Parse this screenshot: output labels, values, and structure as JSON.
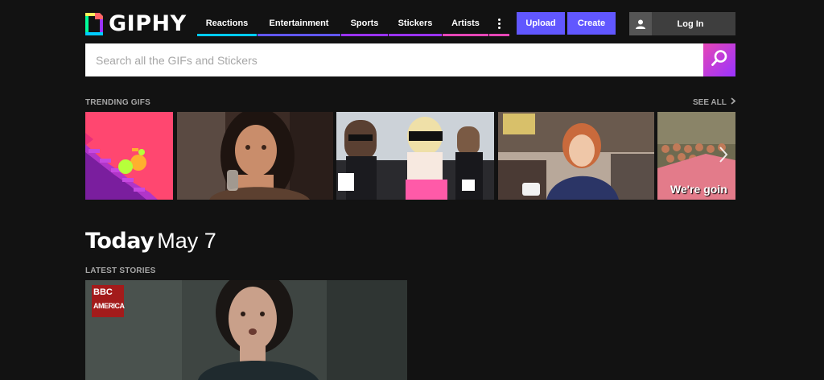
{
  "brand": {
    "name": "GIPHY"
  },
  "nav": {
    "items": [
      {
        "label": "Reactions",
        "color": "#00ccff"
      },
      {
        "label": "Entertainment",
        "color": "#6157ff"
      },
      {
        "label": "Sports",
        "color": "#9933ff"
      },
      {
        "label": "Stickers",
        "color": "#9933ff"
      },
      {
        "label": "Artists",
        "color": "#e646b6"
      }
    ],
    "more_icon": "more-vertical-icon",
    "more_color": "#e646b6"
  },
  "header": {
    "upload_label": "Upload",
    "create_label": "Create",
    "login_label": "Log In",
    "login_icon": "user-icon",
    "accent": "#6157ff"
  },
  "search": {
    "placeholder": "Search all the GIFs and Stickers",
    "value": "",
    "icon": "search-icon"
  },
  "trending": {
    "title": "TRENDING GIFS",
    "see_all_label": "SEE ALL",
    "see_all_icon": "chevron-right-icon",
    "next_icon": "chevron-right-icon",
    "items": [
      {
        "name": "stairs-cartoon-gif"
      },
      {
        "name": "woman-drinking-gif"
      },
      {
        "name": "red-carpet-gif"
      },
      {
        "name": "office-woman-gif"
      },
      {
        "name": "crowd-gif",
        "caption": "We're goin"
      }
    ]
  },
  "today": {
    "title_bold": "Today",
    "date": "May 7"
  },
  "stories": {
    "title": "LATEST STORIES",
    "badge_lines": [
      "BBC",
      "AMERICA"
    ]
  }
}
